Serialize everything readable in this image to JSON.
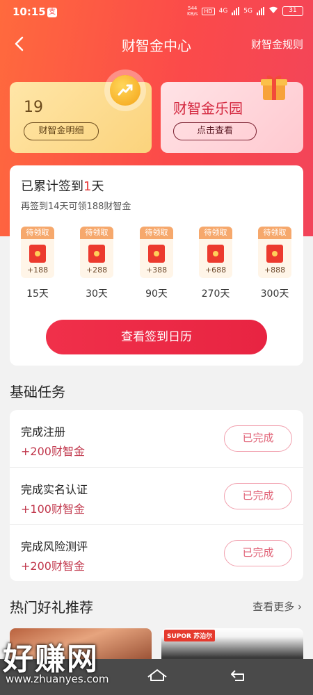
{
  "status": {
    "time": "10:15",
    "app_badge": "支",
    "speed": "544\nKB/s",
    "hd": "HD",
    "net1": "4G",
    "net2": "5G",
    "battery": "31"
  },
  "nav": {
    "title": "财智金中心",
    "rules": "财智金规则"
  },
  "coin_card": {
    "value": "19",
    "button": "财智金明细"
  },
  "park_card": {
    "title": "财智金乐园",
    "button": "点击查看"
  },
  "signin": {
    "title_prefix": "已累计签到",
    "days": "1",
    "title_suffix": "天",
    "subtitle": "再签到14天可领188财智金",
    "rewards": [
      {
        "tag": "待领取",
        "amount": "+188",
        "day": "15天"
      },
      {
        "tag": "待领取",
        "amount": "+288",
        "day": "30天"
      },
      {
        "tag": "待领取",
        "amount": "+388",
        "day": "90天"
      },
      {
        "tag": "待领取",
        "amount": "+688",
        "day": "270天"
      },
      {
        "tag": "待领取",
        "amount": "+888",
        "day": "300天"
      }
    ],
    "calendar_button": "查看签到日历"
  },
  "tasks": {
    "title": "基础任务",
    "items": [
      {
        "name": "完成注册",
        "reward": "+200财智金",
        "status": "已完成"
      },
      {
        "name": "完成实名认证",
        "reward": "+100财智金",
        "status": "已完成"
      },
      {
        "name": "完成风险测评",
        "reward": "+200财智金",
        "status": "已完成"
      }
    ]
  },
  "gifts": {
    "title": "热门好礼推荐",
    "more": "查看更多",
    "brand": "SUPOR 苏泊尔"
  },
  "watermark": {
    "text": "好赚网",
    "url": "www.zhuanyes.com"
  },
  "colors": {
    "brand_red": "#e83b3b",
    "coin_gold": "#fbd37c",
    "task_reward": "#c0354a"
  }
}
